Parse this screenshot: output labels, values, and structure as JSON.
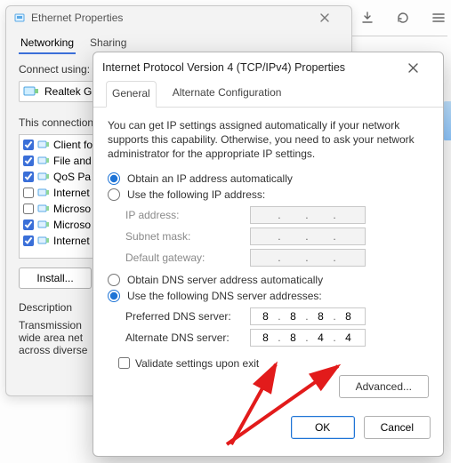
{
  "back": {
    "title": "Ethernet Properties",
    "tabs": [
      "Networking",
      "Sharing"
    ],
    "active_tab": 0,
    "connect_label": "Connect using:",
    "adapter": "Realtek G",
    "list_label": "This connection",
    "items": [
      {
        "checked": true,
        "label": "Client fo"
      },
      {
        "checked": true,
        "label": "File and"
      },
      {
        "checked": true,
        "label": "QoS Pa"
      },
      {
        "checked": false,
        "label": "Internet"
      },
      {
        "checked": false,
        "label": "Microso"
      },
      {
        "checked": true,
        "label": "Microso"
      },
      {
        "checked": true,
        "label": "Internet"
      }
    ],
    "install_button": "Install...",
    "description_label": "Description",
    "description_text": "Transmission wide area net across diverse"
  },
  "front": {
    "title": "Internet Protocol Version 4 (TCP/IPv4) Properties",
    "tabs": [
      "General",
      "Alternate Configuration"
    ],
    "active_tab": 0,
    "intro": "You can get IP settings assigned automatically if your network supports this capability. Otherwise, you need to ask your network administrator for the appropriate IP settings.",
    "ip_auto_label": "Obtain an IP address automatically",
    "ip_manual_label": "Use the following IP address:",
    "ip_mode_auto": true,
    "ip_fields": {
      "ip_label": "IP address:",
      "subnet_label": "Subnet mask:",
      "gateway_label": "Default gateway:"
    },
    "dns_auto_label": "Obtain DNS server address automatically",
    "dns_manual_label": "Use the following DNS server addresses:",
    "dns_mode_auto": false,
    "dns_fields": {
      "preferred_label": "Preferred DNS server:",
      "alternate_label": "Alternate DNS server:",
      "preferred": [
        "8",
        "8",
        "8",
        "8"
      ],
      "alternate": [
        "8",
        "8",
        "4",
        "4"
      ]
    },
    "validate_label": "Validate settings upon exit",
    "validate_checked": false,
    "advanced_button": "Advanced...",
    "ok_button": "OK",
    "cancel_button": "Cancel"
  }
}
